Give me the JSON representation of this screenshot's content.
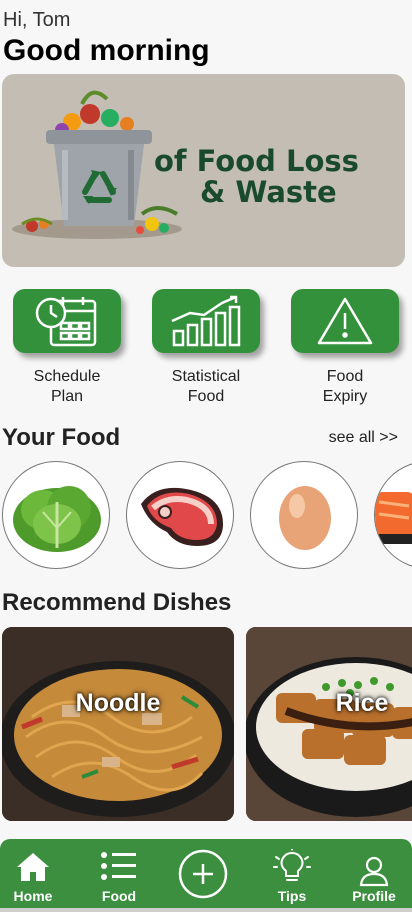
{
  "header": {
    "greeting": "Hi, Tom",
    "headline": "Good morning"
  },
  "banner": {
    "line1": "of Food Loss",
    "line2": "& Waste"
  },
  "actions": [
    {
      "label_line1": "Schedule",
      "label_line2": "Plan",
      "icon": "calendar-clock-icon"
    },
    {
      "label_line1": "Statistical",
      "label_line2": "Food",
      "icon": "bar-chart-icon"
    },
    {
      "label_line1": "Food",
      "label_line2": "Expiry",
      "icon": "warning-icon"
    }
  ],
  "your_food": {
    "title": "Your Food",
    "see_all": "see all >>",
    "items": [
      "lettuce",
      "meat",
      "egg",
      "salmon"
    ]
  },
  "recommend": {
    "title": "Recommend Dishes",
    "dishes": [
      {
        "label": "Noodle"
      },
      {
        "label": "Rice"
      }
    ]
  },
  "nav": [
    {
      "label": "Home",
      "icon": "home-icon"
    },
    {
      "label": "Food",
      "icon": "list-icon"
    },
    {
      "label": "",
      "icon": "plus-circle-icon"
    },
    {
      "label": "Tips",
      "icon": "lightbulb-icon"
    },
    {
      "label": "Profile",
      "icon": "user-icon"
    }
  ],
  "colors": {
    "accent_green": "#33913b",
    "nav_green": "#3b8f3e",
    "banner_text": "#1a4a2e"
  }
}
